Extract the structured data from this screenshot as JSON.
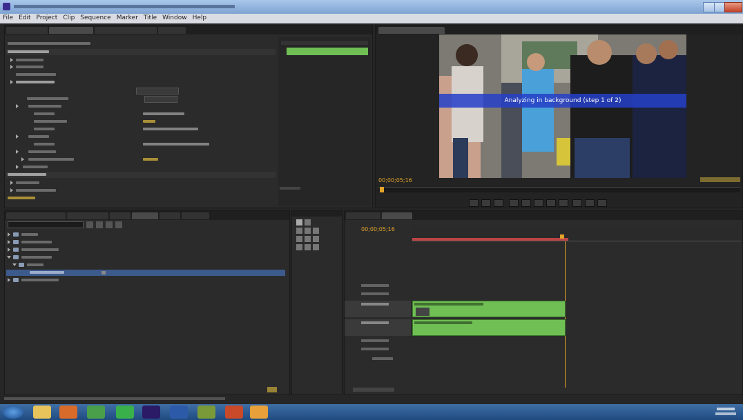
{
  "menu": [
    "File",
    "Edit",
    "Project",
    "Clip",
    "Sequence",
    "Marker",
    "Title",
    "Window",
    "Help"
  ],
  "program_monitor": {
    "overlay_text": "Analyzing in background (step 1 of 2)",
    "timecode": "00;00;05;16"
  },
  "timeline": {
    "timecode": "00;00;05;16"
  },
  "colors": {
    "accent_timecode": "#e2a42b",
    "overlay_band": "#2440c8",
    "clip_green": "#6fbf54"
  }
}
